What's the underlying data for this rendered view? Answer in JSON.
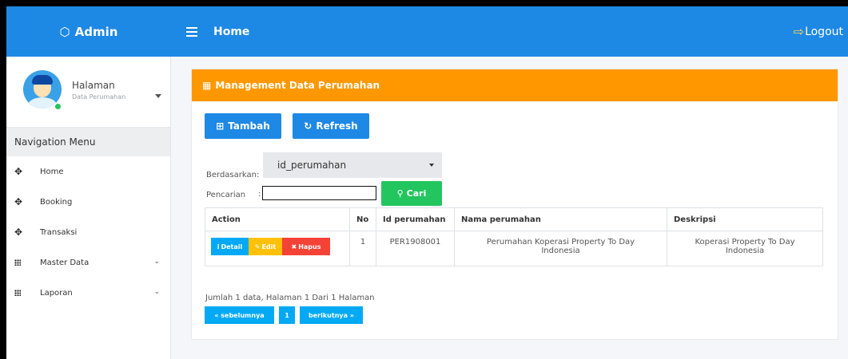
{
  "brand": {
    "title": "Admin"
  },
  "header": {
    "title": "Home",
    "logout_label": "Logout"
  },
  "user": {
    "name": "Halaman",
    "subtitle": "Data Perumahan"
  },
  "sidebar": {
    "section_title": "Navigation Menu",
    "items": [
      {
        "label": "Home",
        "icon": "move-icon",
        "expandable": false
      },
      {
        "label": "Booking",
        "icon": "move-icon",
        "expandable": false
      },
      {
        "label": "Transaksi",
        "icon": "move-icon",
        "expandable": false
      },
      {
        "label": "Master Data",
        "icon": "grid-icon",
        "expandable": true
      },
      {
        "label": "Laporan",
        "icon": "grid-icon",
        "expandable": true
      }
    ]
  },
  "card": {
    "title": "Management Data Perumahan",
    "tambah_label": "Tambah",
    "refresh_label": "Refresh",
    "filter_label": "Berdasarkan:",
    "filter_value": "id_perumahan",
    "search_label": "Pencarian",
    "search_value": "",
    "cari_label": "Cari"
  },
  "table": {
    "headers": [
      "Action",
      "No",
      "Id perumahan",
      "Nama perumahan",
      "Deskripsi"
    ],
    "rows": [
      {
        "no": "1",
        "id": "PER1908001",
        "nama": "Perumahan Koperasi Property To Day Indonesia",
        "deskripsi": "Koperasi Property To Day Indonesia",
        "actions": {
          "detail": "Detail",
          "edit": "Edit",
          "hapus": "Hapus"
        }
      }
    ]
  },
  "summary": "Jumlah 1 data, Halaman 1 Dari 1 Halaman",
  "pagination": {
    "prev": "« sebelumnya",
    "page": "1",
    "next": "berikutnya »"
  },
  "colors": {
    "primary": "#1e88e5",
    "header_orange": "#ff9800",
    "success": "#22c55e",
    "info": "#03a9f4",
    "warning": "#ffc107",
    "danger": "#f44336"
  }
}
